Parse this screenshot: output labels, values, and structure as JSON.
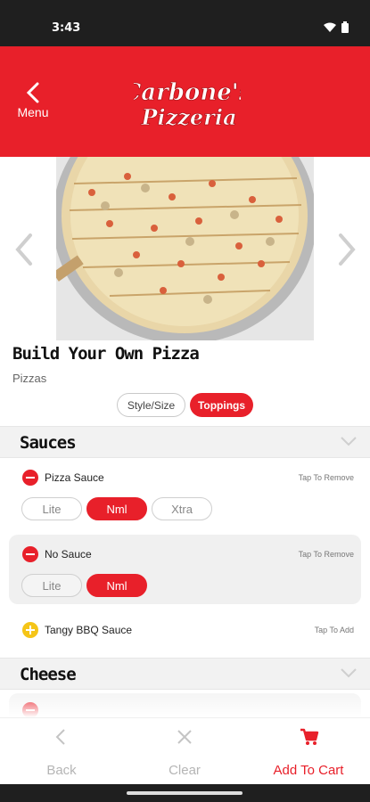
{
  "status": {
    "time": "3:43",
    "wifi_icon": "wifi-icon",
    "battery_icon": "battery-icon"
  },
  "header": {
    "back_label": "Menu",
    "logo_text_1": "Carbone's",
    "logo_text_2": "Pizzeria",
    "brand_color": "#e8202a"
  },
  "product": {
    "title": "Build Your Own Pizza",
    "category": "Pizzas"
  },
  "tabs": {
    "style": "Style/Size",
    "toppings": "Toppings",
    "selected": "Toppings"
  },
  "sections": [
    {
      "title": "Sauces"
    },
    {
      "title": "Cheese"
    }
  ],
  "sauces": [
    {
      "name": "Pizza Sauce",
      "action": "Tap To Remove",
      "state": "remove",
      "amounts": [
        "Lite",
        "Nml",
        "Xtra"
      ],
      "selected": "Nml"
    },
    {
      "name": "No Sauce",
      "action": "Tap To Remove",
      "state": "remove",
      "amounts": [
        "Lite",
        "Nml"
      ],
      "selected": "Nml"
    },
    {
      "name": "Tangy BBQ Sauce",
      "action": "Tap To Add",
      "state": "add"
    }
  ],
  "bottom": {
    "back": "Back",
    "clear": "Clear",
    "add_to_cart": "Add To Cart"
  }
}
